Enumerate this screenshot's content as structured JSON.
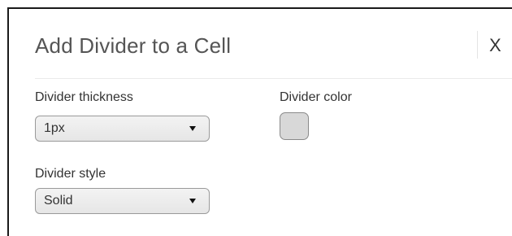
{
  "dialog": {
    "title": "Add Divider to a Cell",
    "close_label": "X"
  },
  "thickness": {
    "label": "Divider thickness",
    "value": "1px"
  },
  "color": {
    "label": "Divider color",
    "value": "#d8d8d8"
  },
  "style": {
    "label": "Divider style",
    "value": "Solid"
  },
  "icons": {
    "dropdown": "caret-down-icon"
  }
}
